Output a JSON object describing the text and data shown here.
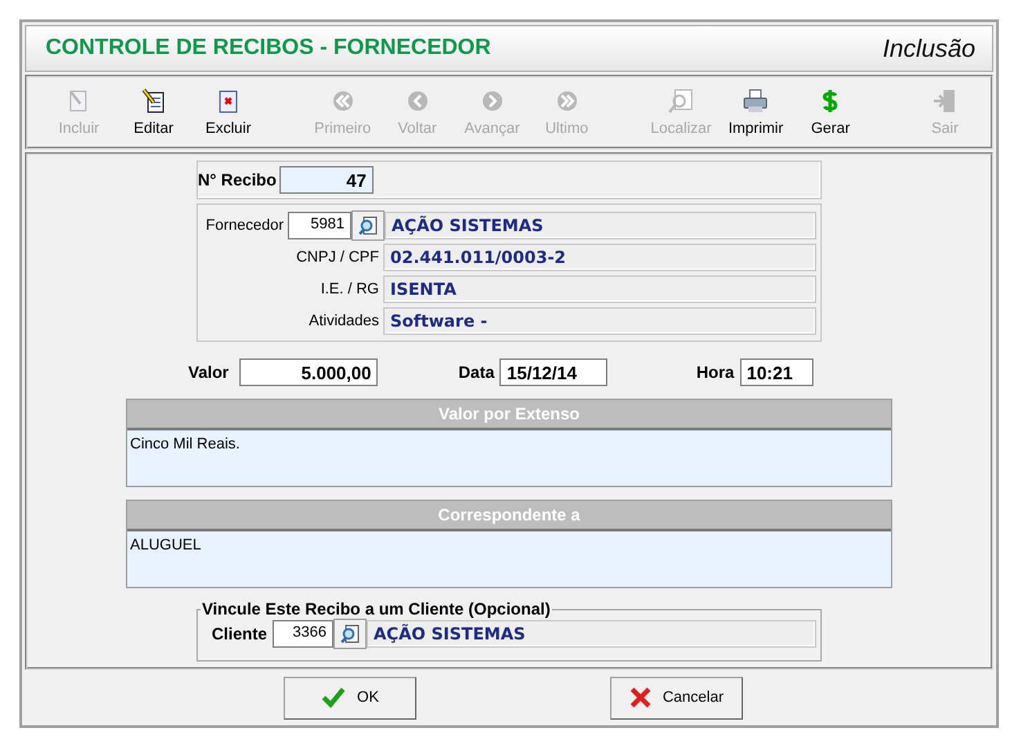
{
  "window": {
    "title": "CONTROLE DE RECIBOS - FORNECEDOR",
    "mode": "Inclusão"
  },
  "toolbar": {
    "groups": [
      [
        {
          "label": "Incluir",
          "disabled": true
        },
        {
          "label": "Editar",
          "disabled": false
        },
        {
          "label": "Excluir",
          "disabled": false
        }
      ],
      [
        {
          "label": "Primeiro",
          "disabled": true
        },
        {
          "label": "Voltar",
          "disabled": true
        },
        {
          "label": "Avançar",
          "disabled": true
        },
        {
          "label": "Ultimo",
          "disabled": true
        }
      ],
      [
        {
          "label": "Localizar",
          "disabled": true
        },
        {
          "label": "Imprimir",
          "disabled": false
        },
        {
          "label": "Gerar",
          "disabled": false
        }
      ],
      [
        {
          "label": "Sair",
          "disabled": true
        }
      ]
    ]
  },
  "recibo": {
    "label": "N° Recibo",
    "value": "47"
  },
  "fornecedor": {
    "label": "Fornecedor",
    "code": "5981",
    "name": "AÇÃO SISTEMAS",
    "details": [
      {
        "label": "CNPJ / CPF",
        "value": "02.441.011/0003-2"
      },
      {
        "label": "I.E. / RG",
        "value": "ISENTA"
      },
      {
        "label": "Atividades",
        "value": "Software -"
      }
    ]
  },
  "valor": {
    "label": "Valor",
    "value": "5.000,00"
  },
  "data": {
    "label": "Data",
    "value": "15/12/14"
  },
  "hora": {
    "label": "Hora",
    "value": "10:21"
  },
  "extenso": {
    "title": "Valor por Extenso",
    "value": "Cinco Mil Reais."
  },
  "correspondente": {
    "title": "Correspondente a",
    "value": "ALUGUEL"
  },
  "vinculo": {
    "legend": "Vincule Este Recibo a um Cliente (Opcional)",
    "label": "Cliente",
    "code": "3366",
    "name": "AÇÃO SISTEMAS"
  },
  "buttons": [
    {
      "label": "OK",
      "kind": "ok"
    },
    {
      "label": "Cancelar",
      "kind": "cancel"
    }
  ]
}
